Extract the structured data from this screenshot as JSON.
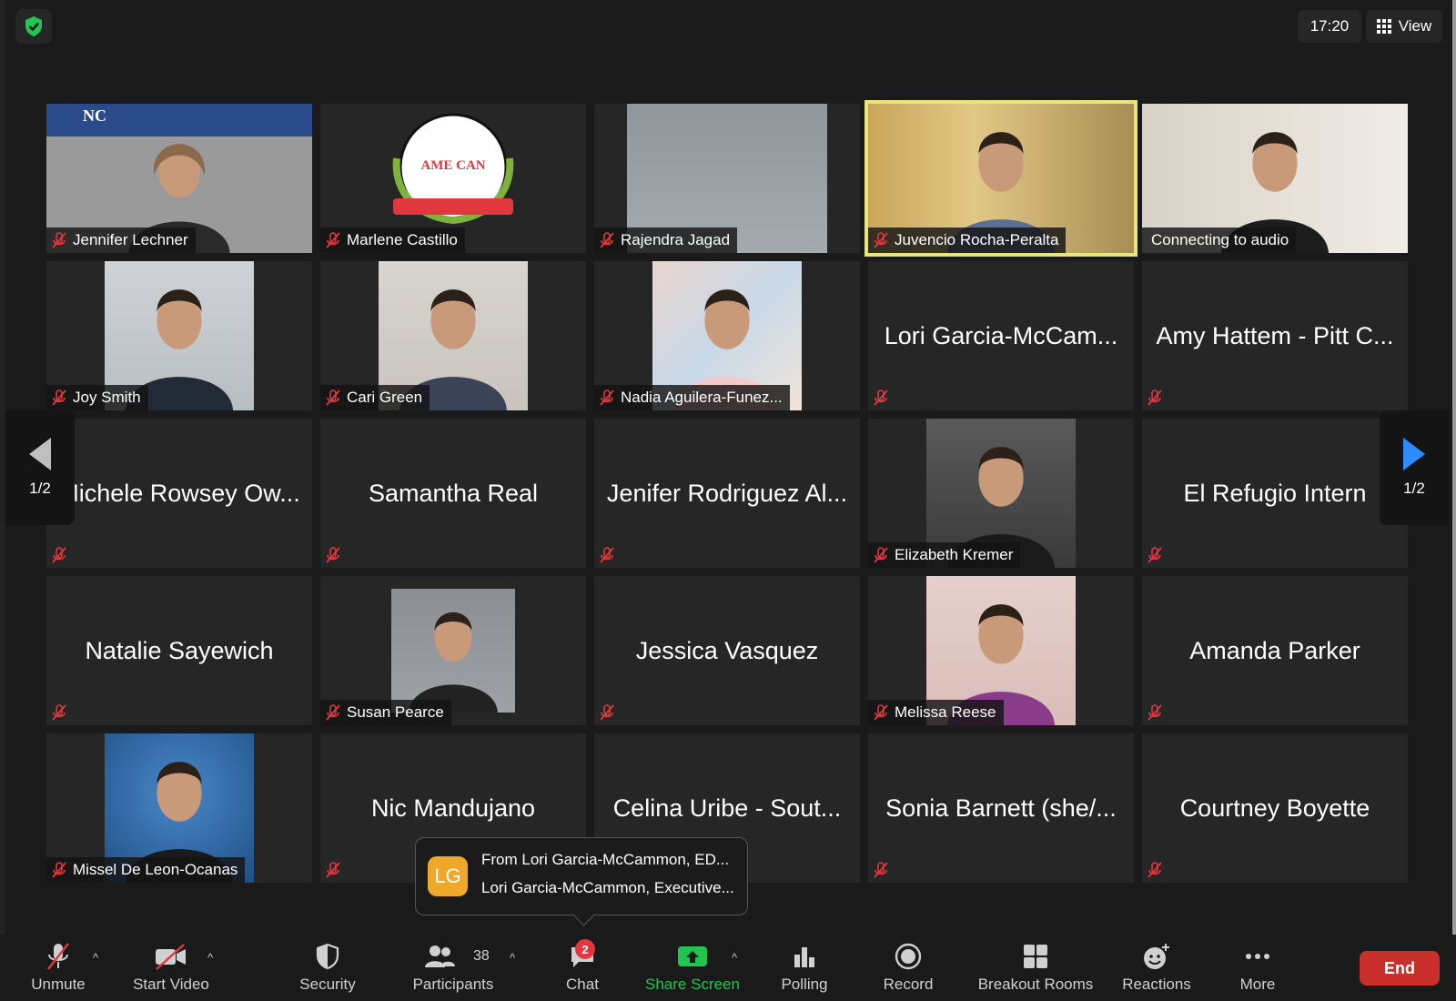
{
  "top": {
    "time": "17:20",
    "view_label": "View"
  },
  "pagination": {
    "left": "1/2",
    "right": "1/2"
  },
  "participants": [
    {
      "name": "Jennifer Lechner",
      "tile_text": ""
    },
    {
      "name": "Marlene Castillo",
      "tile_text": ""
    },
    {
      "name": "Rajendra Jagad",
      "tile_text": ""
    },
    {
      "name": "Juvencio Rocha-Peralta",
      "tile_text": ""
    },
    {
      "name": "Connecting to audio",
      "tile_text": ""
    },
    {
      "name": "Joy Smith",
      "tile_text": ""
    },
    {
      "name": "Cari Green",
      "tile_text": ""
    },
    {
      "name": "Nadia Aguilera-Funez...",
      "tile_text": ""
    },
    {
      "name": "",
      "tile_text": "Lori Garcia-McCam..."
    },
    {
      "name": "",
      "tile_text": "Amy Hattem - Pitt C..."
    },
    {
      "name": "",
      "tile_text": "Michele Rowsey Ow..."
    },
    {
      "name": "",
      "tile_text": "Samantha Real"
    },
    {
      "name": "",
      "tile_text": "Jenifer Rodriguez Al..."
    },
    {
      "name": "Elizabeth Kremer",
      "tile_text": ""
    },
    {
      "name": "",
      "tile_text": "El Refugio Intern"
    },
    {
      "name": "",
      "tile_text": "Natalie Sayewich"
    },
    {
      "name": "Susan Pearce",
      "tile_text": ""
    },
    {
      "name": "",
      "tile_text": "Jessica Vasquez"
    },
    {
      "name": "Melissa Reese",
      "tile_text": ""
    },
    {
      "name": "",
      "tile_text": "Amanda Parker"
    },
    {
      "name": "Missel De Leon-Ocanas",
      "tile_text": ""
    },
    {
      "name": "",
      "tile_text": "Nic Mandujano"
    },
    {
      "name": "",
      "tile_text": "Celina Uribe - Sout..."
    },
    {
      "name": "",
      "tile_text": "Sonia Barnett (she/..."
    },
    {
      "name": "",
      "tile_text": "Courtney Boyette"
    }
  ],
  "photo_text": {
    "nc_logo": "NC",
    "amexcan_logo": "AME CAN"
  },
  "toast": {
    "initials": "LG",
    "line1": "From Lori Garcia-McCammon, ED...",
    "line2": "Lori Garcia-McCammon, Executive..."
  },
  "toolbar": {
    "unmute": "Unmute",
    "start_video": "Start Video",
    "security": "Security",
    "participants": "Participants",
    "participants_count": "38",
    "chat": "Chat",
    "chat_badge": "2",
    "share_screen": "Share Screen",
    "polling": "Polling",
    "record": "Record",
    "breakout_rooms": "Breakout Rooms",
    "reactions": "Reactions",
    "more": "More",
    "end": "End"
  },
  "colors": {
    "accent_blue": "#2d8cff",
    "share_green": "#23c552",
    "end_red": "#c9302c",
    "active_speaker": "#e6e67a"
  }
}
